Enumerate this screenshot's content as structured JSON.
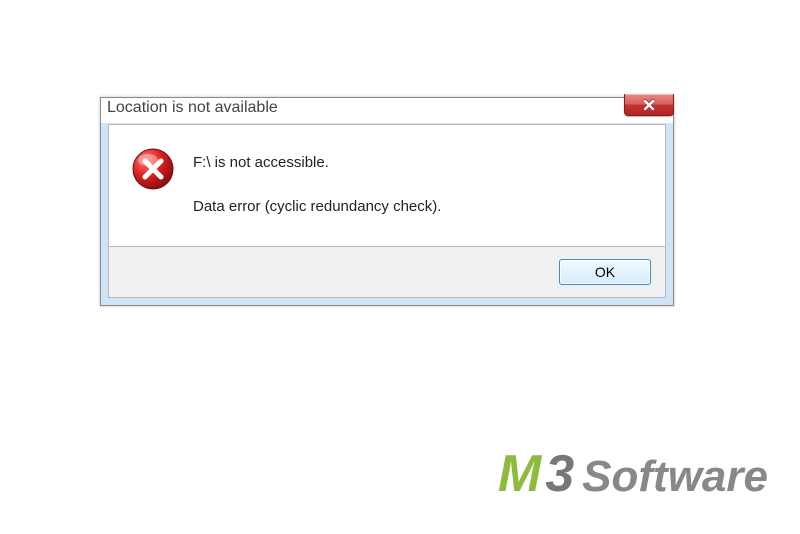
{
  "dialog": {
    "title": "Location is not available",
    "message_primary": "F:\\ is not accessible.",
    "message_secondary": "Data error (cyclic redundancy check).",
    "ok_label": "OK"
  },
  "watermark": {
    "part1": "M",
    "part2": "3",
    "part3": "Software"
  }
}
